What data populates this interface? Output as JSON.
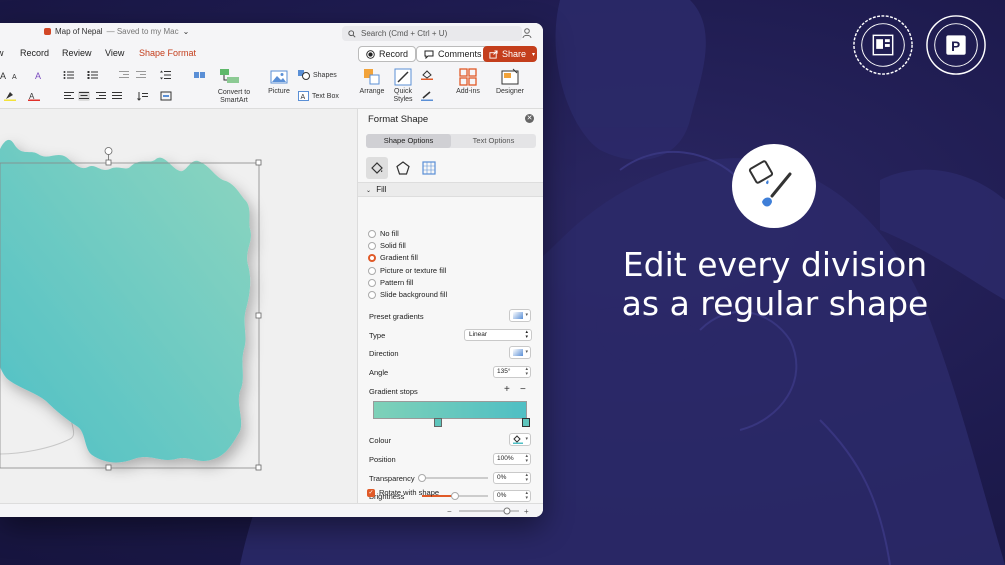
{
  "window": {
    "doc_title": "Map of Nepal",
    "doc_status": "— Saved to my Mac",
    "search_placeholder": "Search (Cmd + Ctrl + U)"
  },
  "tabs": [
    {
      "label": "w"
    },
    {
      "label": "Record"
    },
    {
      "label": "Review"
    },
    {
      "label": "View"
    },
    {
      "label": "Shape Format",
      "active": true
    }
  ],
  "actions": {
    "record": "Record",
    "comments": "Comments",
    "share": "Share"
  },
  "ribbon": {
    "convert_smartart": "Convert to\nSmartArt",
    "picture": "Picture",
    "shapes": "Shapes",
    "text_box": "Text Box",
    "arrange": "Arrange",
    "quick_styles": "Quick\nStyles",
    "add_ins": "Add-ins",
    "designer": "Designer"
  },
  "format_pane": {
    "title": "Format Shape",
    "segment_shape": "Shape Options",
    "segment_text": "Text Options",
    "section": "Fill",
    "fill_options": [
      "No fill",
      "Solid fill",
      "Gradient fill",
      "Picture or texture fill",
      "Pattern fill",
      "Slide background fill"
    ],
    "selected_fill": "Gradient fill",
    "preset_gradients": "Preset gradients",
    "type_label": "Type",
    "type_value": "Linear",
    "direction_label": "Direction",
    "angle_label": "Angle",
    "angle_value": "135°",
    "gradient_stops_label": "Gradient stops",
    "colour_label": "Colour",
    "position_label": "Position",
    "position_value": "100%",
    "transparency_label": "Transparency",
    "transparency_value": "0%",
    "transparency_level": 0.0,
    "brightness_label": "Brightness",
    "brightness_value": "0%",
    "brightness_level": 0.5,
    "rotate_label": "Rotate with shape",
    "rotate_checked": true
  },
  "hero": {
    "line1": "Edit every division",
    "line2": "as a regular shape"
  },
  "colors": {
    "accent": "#c43e1c",
    "radio_accent": "#e05a28",
    "map_fill_start": "#8dd5bf",
    "map_fill_end": "#4fc0c6",
    "background": "#1e1b4f"
  }
}
